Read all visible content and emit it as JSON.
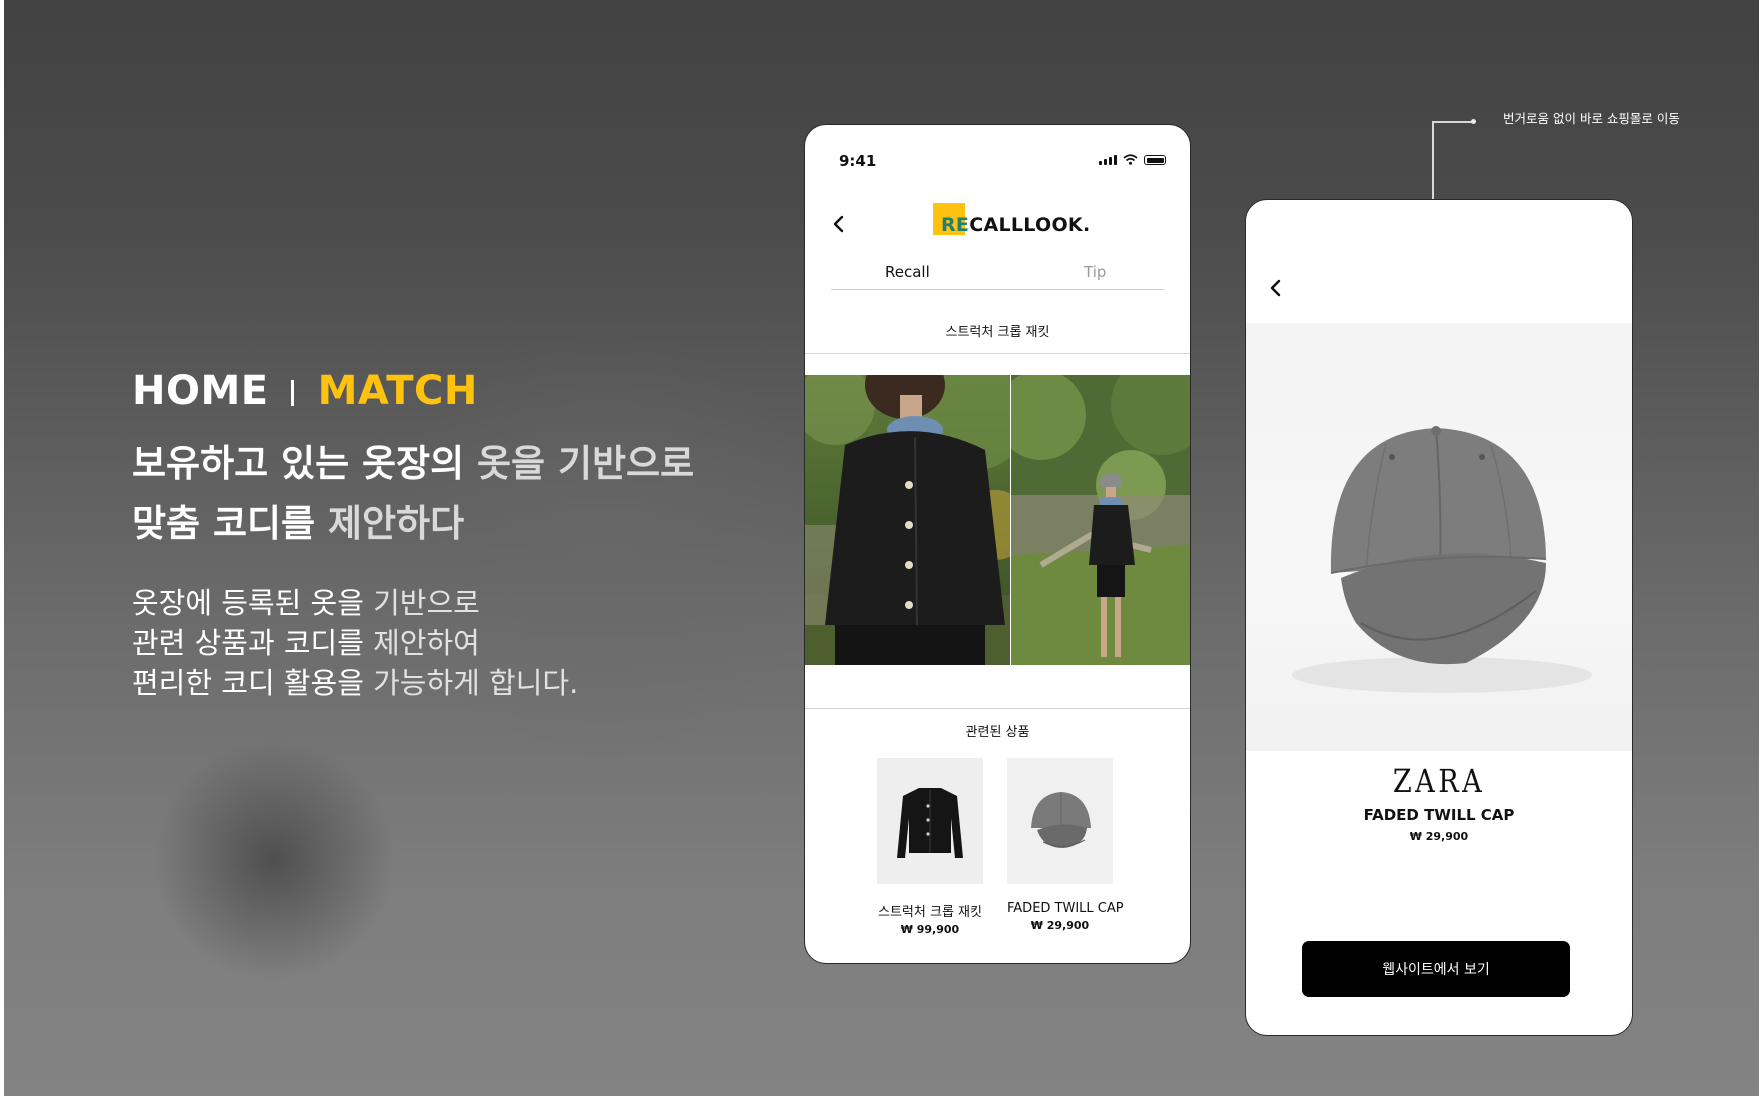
{
  "headline": {
    "home": "HOME",
    "match": "MATCH"
  },
  "title_ko": {
    "line1_a": "보유하고 있는 옷장의 ",
    "line1_b": "옷을 기반으로",
    "line2_a": "맞춤 코디를 ",
    "line2_b": "제안하다"
  },
  "desc_ko": {
    "line1_a": "옷장에 등록된 옷을 ",
    "line1_b": "기반으로",
    "line2_a": "관련 상품과 코디를 ",
    "line2_b": "제안하여",
    "line3_a": "편리한 코디 활용을 ",
    "line3_b": "가능하게 합니다."
  },
  "callout": {
    "text": "번거로움 없이 바로 쇼핑몰로 이동"
  },
  "phone1": {
    "status_time": "9:41",
    "back_icon": "chevron-left-icon",
    "logo": {
      "re": "RE",
      "rest": "CALLLOOK.",
      "color": "#ffc20e",
      "re_color": "#1f7f72"
    },
    "tabs": [
      {
        "label": "Recall",
        "active": true
      },
      {
        "label": "Tip",
        "active": false
      }
    ],
    "item_title": "스트럭처 크롭 재킷",
    "related_title": "관련된 상품",
    "products": [
      {
        "name": "스트럭처 크롭 재킷",
        "price": "₩ 99,900"
      },
      {
        "name": "FADED TWILL CAP",
        "price": "₩ 29,900"
      }
    ]
  },
  "phone2": {
    "back_icon": "chevron-left-icon",
    "brand": "ZARA",
    "product_name": "FADED TWILL CAP",
    "price": "₩ 29,900",
    "cta_label": "웹사이트에서 보기"
  },
  "colors": {
    "accent": "#ffc20e",
    "cta_bg": "#000000"
  }
}
